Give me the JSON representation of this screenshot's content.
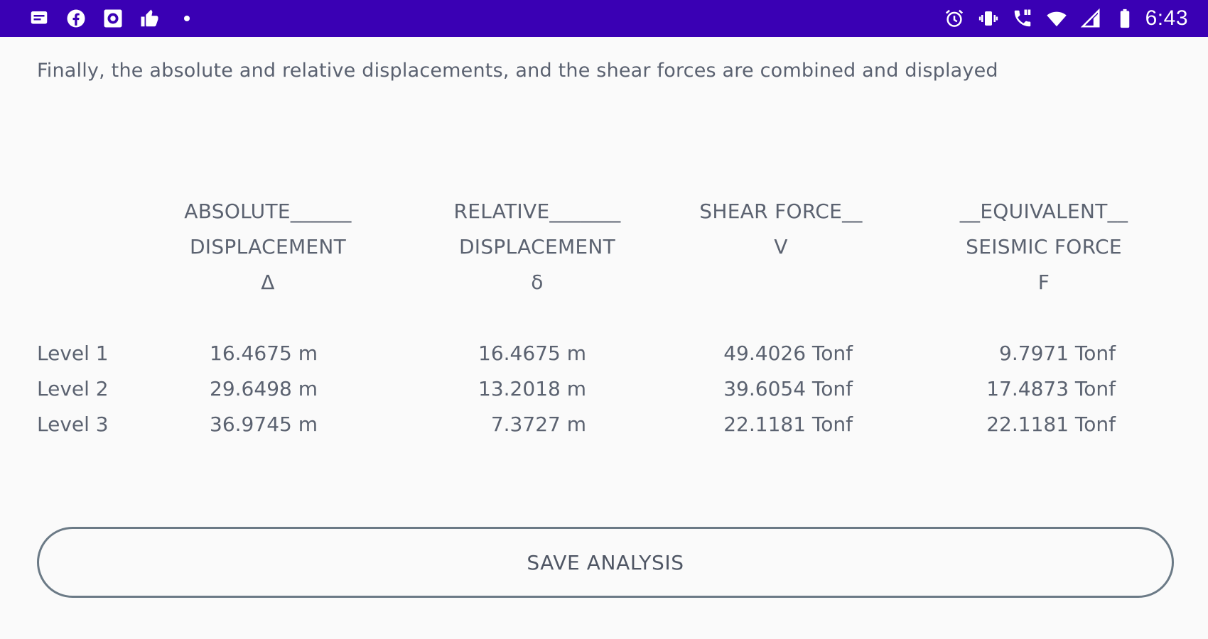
{
  "status_bar": {
    "left_icons": [
      "message-icon",
      "facebook-icon",
      "gallery-icon",
      "thumbs-up-icon",
      "dot-icon"
    ],
    "right_icons": [
      "alarm-icon",
      "vibrate-icon",
      "volte-call-icon",
      "wifi-icon",
      "cell-signal-icon",
      "battery-icon"
    ],
    "time": "6:43",
    "background": "#3a00b4"
  },
  "intro_text": "Finally, the absolute and relative displacements, and the shear forces are combined and displayed",
  "results_table": {
    "columns": [
      {
        "lines": [
          "ABSOLUTE______",
          "DISPLACEMENT",
          "Δ"
        ]
      },
      {
        "lines": [
          "RELATIVE_______",
          "DISPLACEMENT",
          "δ"
        ]
      },
      {
        "lines": [
          "SHEAR FORCE__",
          "V"
        ]
      },
      {
        "lines": [
          "__EQUIVALENT__",
          "SEISMIC FORCE",
          "F"
        ]
      }
    ],
    "rows": [
      {
        "label": "Level 1",
        "values": [
          "16.4675 m",
          "16.4675 m",
          "49.4026 Tonf",
          "9.7971 Tonf"
        ]
      },
      {
        "label": "Level 2",
        "values": [
          "29.6498 m",
          "13.2018 m",
          "39.6054 Tonf",
          "17.4873 Tonf"
        ]
      },
      {
        "label": "Level 3",
        "values": [
          "36.9745 m",
          "7.3727 m",
          "22.1181 Tonf",
          "22.1181 Tonf"
        ]
      }
    ]
  },
  "save_button": {
    "label": "SAVE ANALYSIS"
  }
}
